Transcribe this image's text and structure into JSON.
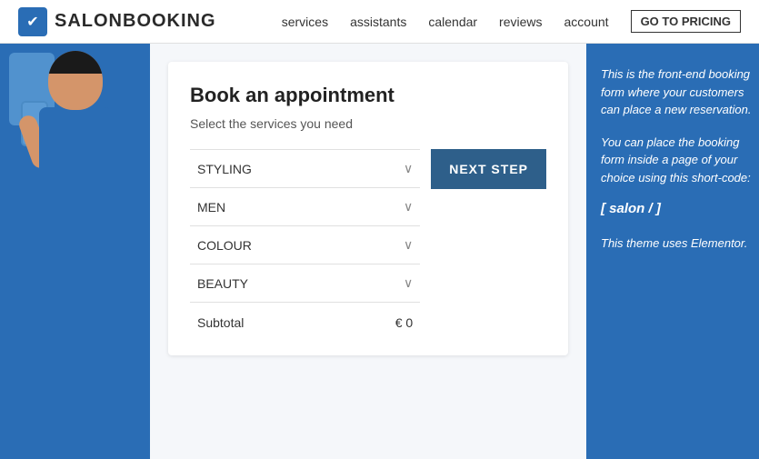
{
  "header": {
    "logo_text": "SALONBOOKING",
    "logo_icon": "✔",
    "nav": {
      "items": [
        {
          "label": "services",
          "id": "services"
        },
        {
          "label": "assistants",
          "id": "assistants"
        },
        {
          "label": "calendar",
          "id": "calendar"
        },
        {
          "label": "reviews",
          "id": "reviews"
        },
        {
          "label": "account",
          "id": "account"
        }
      ],
      "pricing_label": "GO TO PRICING"
    }
  },
  "booking": {
    "title": "Book an appointment",
    "subtitle": "Select the services you need",
    "services": [
      {
        "name": "STYLING",
        "id": "styling"
      },
      {
        "name": "MEN",
        "id": "men"
      },
      {
        "name": "COLOUR",
        "id": "colour"
      },
      {
        "name": "BEAUTY",
        "id": "beauty"
      }
    ],
    "next_step_label": "NEXT STEP",
    "subtotal_label": "Subtotal",
    "subtotal_amount": "€ 0"
  },
  "info_panel": {
    "text1": "This is the front-end booking form where your customers can place a new reservation.",
    "text2": "You can place the booking form inside a page of your choice using this short-code:",
    "shortcode": "[ salon / ]",
    "text3": "This theme uses Elementor."
  },
  "icons": {
    "chevron": "∨",
    "logo_check": "✔"
  }
}
